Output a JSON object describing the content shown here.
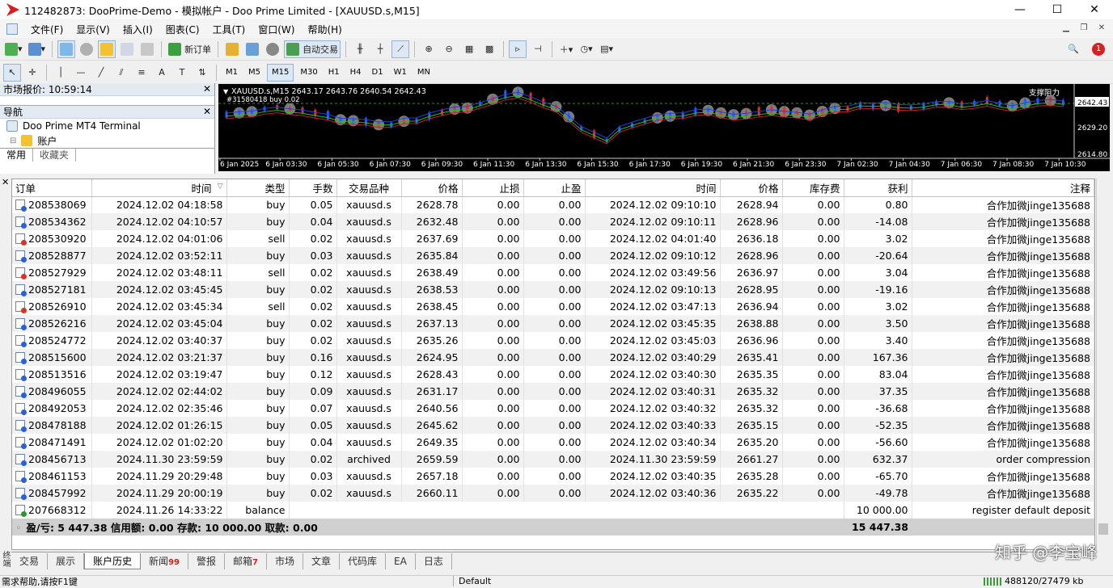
{
  "window": {
    "title": "112482873: DooPrime-Demo - 模拟帐户 - Doo Prime Limited - [XAUUSD.s,M15]",
    "minimize": "—",
    "maximize": "☐",
    "close": "✕"
  },
  "menu": [
    "文件(F)",
    "显示(V)",
    "插入(I)",
    "图表(C)",
    "工具(T)",
    "窗口(W)",
    "帮助(H)"
  ],
  "toolbar": {
    "new_order": "新订单",
    "auto_trading": "自动交易",
    "notification_count": "1"
  },
  "timeframes": [
    "M1",
    "M5",
    "M15",
    "M30",
    "H1",
    "H4",
    "D1",
    "W1",
    "MN"
  ],
  "selected_timeframe": "M15",
  "market_watch": {
    "title": "市场报价: 10:59:14"
  },
  "navigator": {
    "title": "导航",
    "items": [
      "Doo Prime MT4 Terminal",
      "账户"
    ],
    "tabs": [
      "常用",
      "收藏夹"
    ]
  },
  "chart": {
    "header": "XAUUSD.s,M15  2643.17 2643.76 2640.54 2642.43",
    "sub_header": "#31580418 buy 0.02",
    "right_label": "支撑阻力",
    "price_labels": [
      "2642.43",
      "2629.20",
      "2614.80"
    ],
    "time_labels": [
      "6 Jan 2025",
      "6 Jan 03:30",
      "6 Jan 05:30",
      "6 Jan 07:30",
      "6 Jan 09:30",
      "6 Jan 11:30",
      "6 Jan 13:30",
      "6 Jan 15:30",
      "6 Jan 17:30",
      "6 Jan 19:30",
      "6 Jan 21:30",
      "6 Jan 23:30",
      "7 Jan 02:30",
      "7 Jan 04:30",
      "7 Jan 06:30",
      "7 Jan 08:30",
      "7 Jan 10:30"
    ],
    "colors": {
      "bg": "#000000",
      "bull": "#e03030",
      "bear": "#2060ff",
      "ma_red": "#c82020",
      "ma_green": "#20c020",
      "ma_blue": "#2040e0"
    }
  },
  "history": {
    "columns": [
      "订单",
      "时间",
      "类型",
      "手数",
      "交易品种",
      "价格",
      "止损",
      "止盈",
      "时间",
      "价格",
      "库存费",
      "获利",
      "注释"
    ],
    "rows": [
      [
        "208538069",
        "2024.12.02 04:18:58",
        "buy",
        "0.05",
        "xauusd.s",
        "2628.78",
        "0.00",
        "0.00",
        "2024.12.02 09:10:10",
        "2628.94",
        "0.00",
        "0.80",
        "合作加微jinge135688"
      ],
      [
        "208534362",
        "2024.12.02 04:10:57",
        "buy",
        "0.04",
        "xauusd.s",
        "2632.48",
        "0.00",
        "0.00",
        "2024.12.02 09:10:11",
        "2628.96",
        "0.00",
        "-14.08",
        "合作加微jinge135688"
      ],
      [
        "208530920",
        "2024.12.02 04:01:06",
        "sell",
        "0.02",
        "xauusd.s",
        "2637.69",
        "0.00",
        "0.00",
        "2024.12.02 04:01:40",
        "2636.18",
        "0.00",
        "3.02",
        "合作加微jinge135688"
      ],
      [
        "208528877",
        "2024.12.02 03:52:11",
        "buy",
        "0.03",
        "xauusd.s",
        "2635.84",
        "0.00",
        "0.00",
        "2024.12.02 09:10:12",
        "2628.96",
        "0.00",
        "-20.64",
        "合作加微jinge135688"
      ],
      [
        "208527929",
        "2024.12.02 03:48:11",
        "sell",
        "0.02",
        "xauusd.s",
        "2638.49",
        "0.00",
        "0.00",
        "2024.12.02 03:49:56",
        "2636.97",
        "0.00",
        "3.04",
        "合作加微jinge135688"
      ],
      [
        "208527181",
        "2024.12.02 03:45:45",
        "buy",
        "0.02",
        "xauusd.s",
        "2638.53",
        "0.00",
        "0.00",
        "2024.12.02 09:10:13",
        "2628.95",
        "0.00",
        "-19.16",
        "合作加微jinge135688"
      ],
      [
        "208526910",
        "2024.12.02 03:45:34",
        "sell",
        "0.02",
        "xauusd.s",
        "2638.45",
        "0.00",
        "0.00",
        "2024.12.02 03:47:13",
        "2636.94",
        "0.00",
        "3.02",
        "合作加微jinge135688"
      ],
      [
        "208526216",
        "2024.12.02 03:45:04",
        "buy",
        "0.02",
        "xauusd.s",
        "2637.13",
        "0.00",
        "0.00",
        "2024.12.02 03:45:35",
        "2638.88",
        "0.00",
        "3.50",
        "合作加微jinge135688"
      ],
      [
        "208524772",
        "2024.12.02 03:40:37",
        "buy",
        "0.02",
        "xauusd.s",
        "2635.26",
        "0.00",
        "0.00",
        "2024.12.02 03:45:03",
        "2636.96",
        "0.00",
        "3.40",
        "合作加微jinge135688"
      ],
      [
        "208515600",
        "2024.12.02 03:21:37",
        "buy",
        "0.16",
        "xauusd.s",
        "2624.95",
        "0.00",
        "0.00",
        "2024.12.02 03:40:29",
        "2635.41",
        "0.00",
        "167.36",
        "合作加微jinge135688"
      ],
      [
        "208513516",
        "2024.12.02 03:19:47",
        "buy",
        "0.12",
        "xauusd.s",
        "2628.43",
        "0.00",
        "0.00",
        "2024.12.02 03:40:30",
        "2635.35",
        "0.00",
        "83.04",
        "合作加微jinge135688"
      ],
      [
        "208496055",
        "2024.12.02 02:44:02",
        "buy",
        "0.09",
        "xauusd.s",
        "2631.17",
        "0.00",
        "0.00",
        "2024.12.02 03:40:31",
        "2635.32",
        "0.00",
        "37.35",
        "合作加微jinge135688"
      ],
      [
        "208492053",
        "2024.12.02 02:35:46",
        "buy",
        "0.07",
        "xauusd.s",
        "2640.56",
        "0.00",
        "0.00",
        "2024.12.02 03:40:32",
        "2635.32",
        "0.00",
        "-36.68",
        "合作加微jinge135688"
      ],
      [
        "208478188",
        "2024.12.02 01:26:15",
        "buy",
        "0.05",
        "xauusd.s",
        "2645.62",
        "0.00",
        "0.00",
        "2024.12.02 03:40:33",
        "2635.15",
        "0.00",
        "-52.35",
        "合作加微jinge135688"
      ],
      [
        "208471491",
        "2024.12.02 01:02:20",
        "buy",
        "0.04",
        "xauusd.s",
        "2649.35",
        "0.00",
        "0.00",
        "2024.12.02 03:40:34",
        "2635.20",
        "0.00",
        "-56.60",
        "合作加微jinge135688"
      ],
      [
        "208456713",
        "2024.11.30 23:59:59",
        "buy",
        "0.02",
        "archived",
        "2659.59",
        "0.00",
        "0.00",
        "2024.11.30 23:59:59",
        "2661.27",
        "0.00",
        "632.37",
        "order compression"
      ],
      [
        "208461153",
        "2024.11.29 20:29:48",
        "buy",
        "0.03",
        "xauusd.s",
        "2657.18",
        "0.00",
        "0.00",
        "2024.12.02 03:40:35",
        "2635.28",
        "0.00",
        "-65.70",
        "合作加微jinge135688"
      ],
      [
        "208457992",
        "2024.11.29 20:00:19",
        "buy",
        "0.02",
        "xauusd.s",
        "2660.11",
        "0.00",
        "0.00",
        "2024.12.02 03:40:36",
        "2635.22",
        "0.00",
        "-49.78",
        "合作加微jinge135688"
      ],
      [
        "207668312",
        "2024.11.26 14:33:22",
        "balance",
        "",
        "",
        "",
        "",
        "",
        "",
        "",
        "",
        "10 000.00",
        "register default deposit"
      ]
    ],
    "summary_text": "盈/亏: 5 447.38  信用额: 0.00  存款: 10 000.00  取款: 0.00",
    "summary_total": "15 447.38"
  },
  "side_label": "终端",
  "bottom_tabs": [
    {
      "label": "交易"
    },
    {
      "label": "展示"
    },
    {
      "label": "账户历史",
      "active": true
    },
    {
      "label": "新闻",
      "badge": "99"
    },
    {
      "label": "警报"
    },
    {
      "label": "邮箱",
      "badge": "7"
    },
    {
      "label": "市场"
    },
    {
      "label": "文章"
    },
    {
      "label": "代码库"
    },
    {
      "label": "EA"
    },
    {
      "label": "日志"
    }
  ],
  "watermark": "知乎 @李宝峰",
  "status": {
    "help": "需求帮助,请按F1键",
    "profile": "Default",
    "traffic": "488120/27479 kb"
  }
}
